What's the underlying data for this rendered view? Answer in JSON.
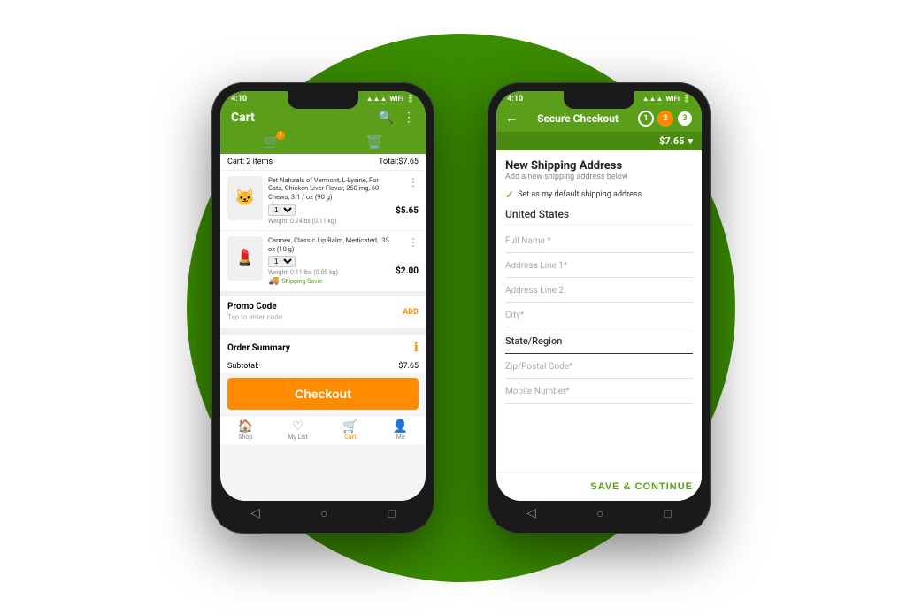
{
  "background": {
    "color": "#3a8c00"
  },
  "cart_phone": {
    "status_bar": {
      "time": "4:10",
      "battery": "100%"
    },
    "header": {
      "title": "Cart",
      "search_icon": "🔍",
      "more_icon": "⋮"
    },
    "tabs": {
      "cart_icon": "🛒",
      "trash_icon": "🗑️",
      "badge": "2"
    },
    "summary": {
      "label": "Cart: 2 items",
      "total": "Total:$7.65"
    },
    "items": [
      {
        "name": "Pet Naturals of Vermont, L-Lysine, For Cats, Chicken Liver Flavor, 250 mg, 60 Chews, 3.1 / oz (90 g)",
        "qty": "1",
        "weight": "Weight: 0.24lbs (0.11 kg)",
        "price": "$5.65",
        "emoji": "🐱"
      },
      {
        "name": "Carmex, Classic Lip Balm, Medicated, .35 oz (10 g)",
        "qty": "1",
        "weight": "Weight: 0.11 lbs (0.05 kg)",
        "price": "$2.00",
        "shipping_saver": "✦ Shipping Saver",
        "emoji": "💄"
      }
    ],
    "promo": {
      "title": "Promo Code",
      "add_label": "ADD",
      "placeholder": "Tap to enter code"
    },
    "order_summary": {
      "title": "Order Summary",
      "subtotal_label": "Subtotal:",
      "subtotal_value": "$7.65"
    },
    "checkout_btn": "Checkout",
    "bottom_nav": [
      {
        "label": "Shop",
        "icon": "🏠",
        "active": false
      },
      {
        "label": "My List",
        "icon": "♡",
        "active": false
      },
      {
        "label": "Cart",
        "icon": "🛒",
        "active": true
      },
      {
        "label": "Me",
        "icon": "👤",
        "active": false
      }
    ]
  },
  "checkout_phone": {
    "status_bar": {
      "time": "4:10"
    },
    "header": {
      "back_icon": "←",
      "title": "Secure Checkout"
    },
    "steps": [
      {
        "number": "1",
        "state": "outlined"
      },
      {
        "number": "2",
        "state": "active"
      },
      {
        "number": "3",
        "state": "inactive"
      }
    ],
    "total_bar": {
      "amount": "$7.65",
      "chevron": "▾"
    },
    "form": {
      "title": "New Shipping Address",
      "subtitle": "Add a new shipping address below",
      "default_check": "Set as my default shipping address",
      "country": "United States",
      "fields": [
        {
          "placeholder": "Full Name *",
          "type": "text"
        },
        {
          "placeholder": "Address Line 1*",
          "type": "text"
        },
        {
          "placeholder": "Address Line 2",
          "type": "text"
        },
        {
          "placeholder": "City*",
          "type": "text"
        },
        {
          "placeholder": "State/Region",
          "type": "section_label"
        },
        {
          "placeholder": "Zip/Postal Code*",
          "type": "text"
        },
        {
          "placeholder": "Mobile Number*",
          "type": "text"
        }
      ]
    },
    "save_btn": "SAVE & CONTINUE"
  }
}
